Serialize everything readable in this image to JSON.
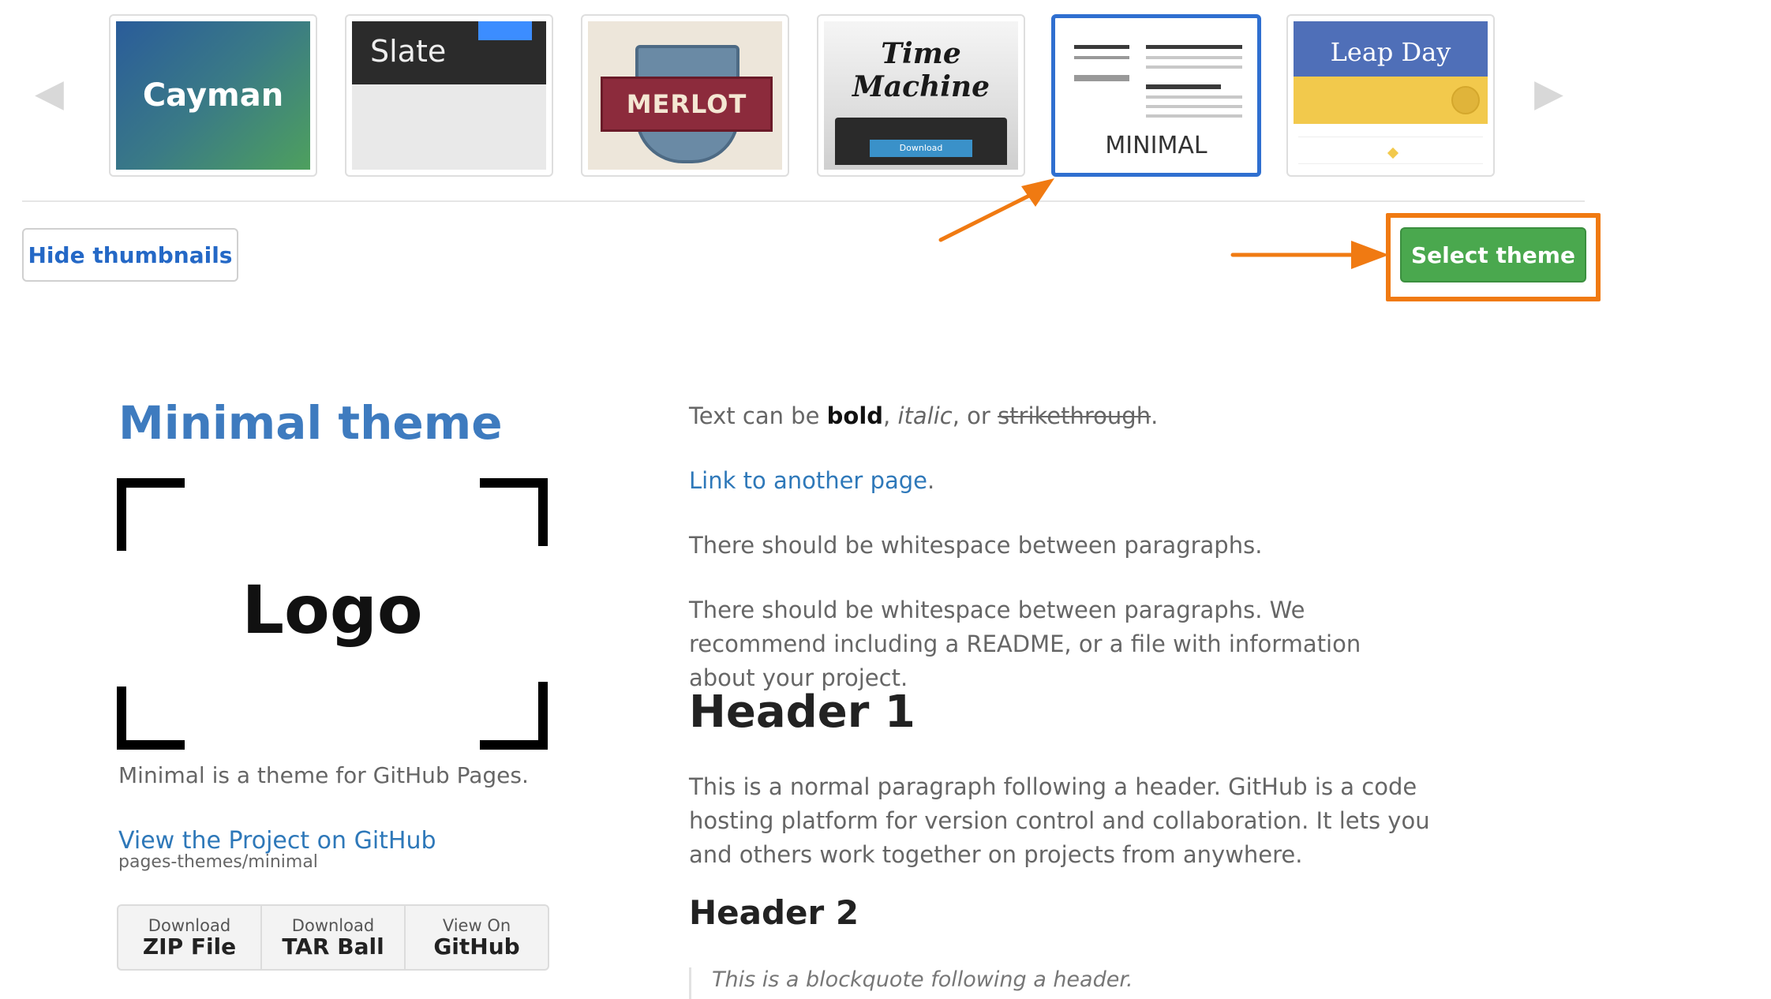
{
  "carousel": {
    "prev_arrow": "◀",
    "next_arrow": "▶",
    "themes": [
      {
        "name": "Cayman",
        "label": "Cayman"
      },
      {
        "name": "Slate",
        "label": "Slate"
      },
      {
        "name": "Merlot",
        "label": "MERLOT"
      },
      {
        "name": "Time Machine",
        "label_line1": "Time",
        "label_line2": "Machine",
        "download_label": "Download"
      },
      {
        "name": "Minimal",
        "label": "MINIMAL",
        "selected": true
      },
      {
        "name": "Leap Day",
        "label": "Leap Day"
      }
    ]
  },
  "toolbar": {
    "hide_thumbnails_label": "Hide thumbnails",
    "select_theme_label": "Select theme"
  },
  "annotation_color": "#f07a12",
  "preview": {
    "sidebar": {
      "title": "Minimal theme",
      "logo_text": "Logo",
      "description": "Minimal is a theme for GitHub Pages.",
      "project_link": "View the Project on GitHub",
      "repo": "pages-themes/minimal",
      "downloads": [
        {
          "top": "Download",
          "bottom": "ZIP File"
        },
        {
          "top": "Download",
          "bottom": "TAR Ball"
        },
        {
          "top": "View On",
          "bottom": "GitHub"
        }
      ]
    },
    "main": {
      "p1": {
        "pre": "Text can be ",
        "bold": "bold",
        "sep1": ", ",
        "italic": "italic",
        "sep2": ", or ",
        "strike": "strikethrough",
        "post": "."
      },
      "link": {
        "text": "Link to another page",
        "post": "."
      },
      "p2": "There should be whitespace between paragraphs.",
      "p3": "There should be whitespace between paragraphs. We recommend including a README, or a file with information about your project.",
      "h1": "Header 1",
      "p4": "This is a normal paragraph following a header. GitHub is a code hosting platform for version control and collaboration. It lets you and others work together on projects from anywhere.",
      "h2": "Header 2",
      "blockquote": "This is a blockquote following a header."
    }
  }
}
